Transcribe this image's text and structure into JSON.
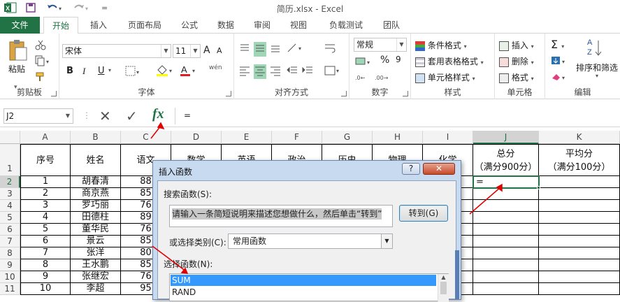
{
  "window": {
    "title": "简历.xlsx - Excel"
  },
  "quick_access": {
    "save_icon": "save-icon",
    "undo_icon": "undo-icon",
    "redo_icon": "redo-icon",
    "more": "="
  },
  "tabs": [
    "文件",
    "开始",
    "插入",
    "页面布局",
    "公式",
    "数据",
    "审阅",
    "视图",
    "负载测试",
    "团队"
  ],
  "ribbon": {
    "clipboard": {
      "paste": "粘贴",
      "label": "剪贴板"
    },
    "font": {
      "name": "宋体",
      "size": "11",
      "grow": "A",
      "shrink": "A",
      "bold": "B",
      "italic": "I",
      "underline": "U",
      "color_letter": "A",
      "wen": "wén",
      "label": "字体"
    },
    "alignment": {
      "label": "对齐方式"
    },
    "number": {
      "format": "常规",
      "percent": "%",
      "comma": "9",
      "label": "数字"
    },
    "styles": {
      "cond": "条件格式",
      "table": "套用表格格式",
      "cell": "单元格样式",
      "label": "样式"
    },
    "cells": {
      "insert": "插入",
      "delete": "删除",
      "format": "格式",
      "label": "单元格"
    },
    "editing": {
      "sort": "排序和筛选",
      "label": "编辑"
    }
  },
  "formula_bar": {
    "name_box": "J2",
    "content": "=",
    "fx": "fx"
  },
  "columns": [
    "A",
    "B",
    "C",
    "D",
    "E",
    "F",
    "G",
    "H",
    "I",
    "J",
    "K"
  ],
  "headers": {
    "A": "序号",
    "B": "姓名",
    "C": "语文",
    "D": "数学",
    "E": "英语",
    "F": "政治",
    "G": "历史",
    "H": "物理",
    "I": "化学",
    "J1": "总分",
    "J2": "（满分900分）",
    "K1": "平均分",
    "K2": "（满分100分）"
  },
  "rows": [
    {
      "n": "1",
      "a": "",
      "b": "",
      "c": ""
    },
    {
      "n": "2",
      "a": "1",
      "b": "胡春清",
      "c": "88",
      "j": "="
    },
    {
      "n": "3",
      "a": "2",
      "b": "商京燕",
      "c": "85"
    },
    {
      "n": "4",
      "a": "3",
      "b": "罗巧丽",
      "c": "76"
    },
    {
      "n": "5",
      "a": "4",
      "b": "田德柱",
      "c": "89"
    },
    {
      "n": "6",
      "a": "5",
      "b": "董华民",
      "c": "76"
    },
    {
      "n": "7",
      "a": "6",
      "b": "景云",
      "c": "85"
    },
    {
      "n": "8",
      "a": "7",
      "b": "张洋",
      "c": "80"
    },
    {
      "n": "9",
      "a": "8",
      "b": "王水鹏",
      "c": "85"
    },
    {
      "n": "10",
      "a": "9",
      "b": "张继宏",
      "c": "76"
    },
    {
      "n": "11",
      "a": "10",
      "b": "李超",
      "c": "95"
    }
  ],
  "dialog": {
    "title": "插入函数",
    "help": "?",
    "close": "✕",
    "search_label": "搜索函数(S):",
    "search_text": "请输入一条简短说明来描述您想做什么，然后单击“转到”",
    "go_button": "转到(G)",
    "category_label": "或选择类别(C):",
    "category_value": "常用函数",
    "function_label": "选择函数(N):",
    "functions": [
      "SUM",
      "RAND"
    ]
  }
}
